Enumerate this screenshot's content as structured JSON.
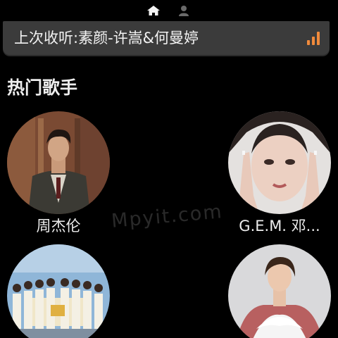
{
  "top_nav": {
    "icons": [
      "home-icon",
      "user-icon"
    ],
    "active": "home-icon"
  },
  "last_played": {
    "text": "上次收听:素颜-许嵩&何曼婷",
    "icon": "audio-bars-icon",
    "accent_color": "#f08a3c"
  },
  "section": {
    "title": "热门歌手"
  },
  "artists": [
    {
      "name": "周杰伦"
    },
    {
      "name": "G.E.M. 邓..."
    },
    {
      "name": ""
    },
    {
      "name": ""
    }
  ],
  "watermark": {
    "text": "Mpyit.com"
  }
}
